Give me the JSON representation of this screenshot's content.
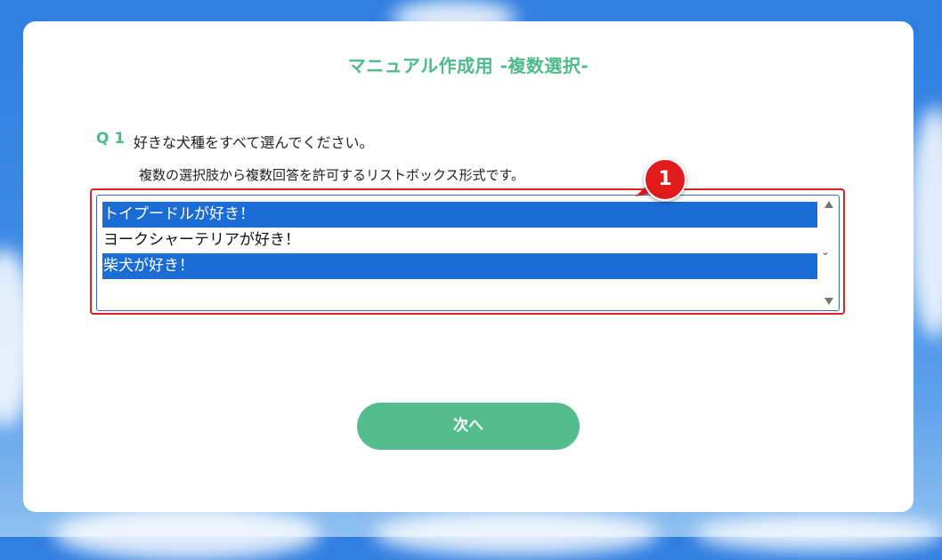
{
  "page": {
    "title": "マニュアル作成用 -複数選択-"
  },
  "question": {
    "number": "Q 1",
    "text": "好きな犬種をすべて選んでください。",
    "subtext": "複数の選択肢から複数回答を許可するリストボックス形式です。"
  },
  "listbox": {
    "options": [
      {
        "label": "トイプードルが好き！",
        "selected": true
      },
      {
        "label": "ヨークシャーテリアが好き！",
        "selected": false
      },
      {
        "label": "柴犬が好き！",
        "selected": true
      }
    ]
  },
  "annotation": {
    "number": "1",
    "color": "#e11b1b"
  },
  "buttons": {
    "next_label": "次へ"
  },
  "colors": {
    "accent": "#4dba8a",
    "button": "#55bc8d",
    "selection": "#1c6cd6"
  }
}
